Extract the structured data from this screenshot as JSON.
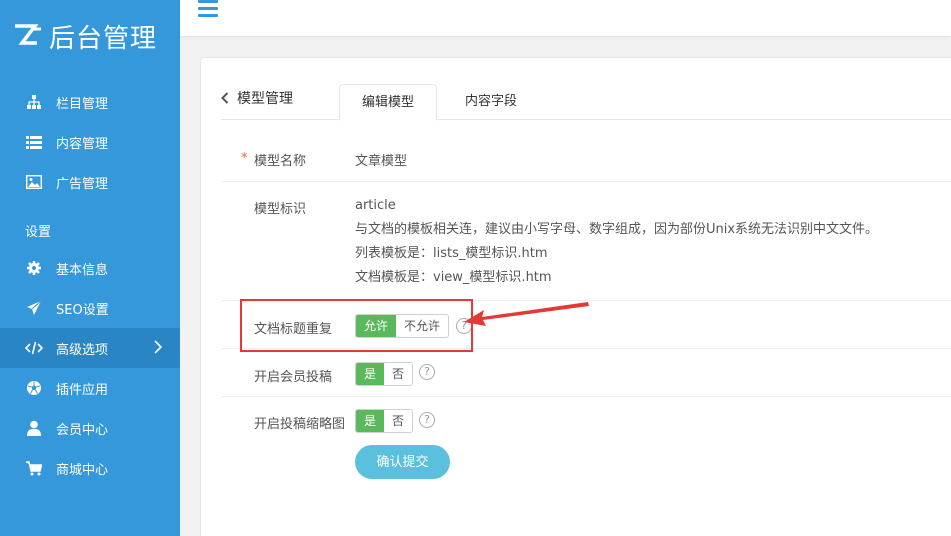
{
  "app": {
    "title": "后台管理",
    "brand_color": "#3498db"
  },
  "sidebar": {
    "items": [
      {
        "label": "栏目管理",
        "icon": "sitemap-icon"
      },
      {
        "label": "内容管理",
        "icon": "list-icon"
      },
      {
        "label": "广告管理",
        "icon": "image-icon"
      }
    ],
    "section_title": "设置",
    "settings": [
      {
        "label": "基本信息",
        "icon": "gear-icon"
      },
      {
        "label": "SEO设置",
        "icon": "send-icon"
      },
      {
        "label": "高级选项",
        "icon": "code-icon",
        "active": true
      },
      {
        "label": "插件应用",
        "icon": "soccer-icon"
      },
      {
        "label": "会员中心",
        "icon": "user-icon"
      },
      {
        "label": "商城中心",
        "icon": "cart-icon"
      }
    ]
  },
  "header": {
    "menu_icon": "hamburger-icon"
  },
  "tabs": {
    "back_label": "模型管理",
    "items": [
      {
        "label": "编辑模型",
        "active": true
      },
      {
        "label": "内容字段",
        "active": false
      }
    ]
  },
  "form": {
    "model_name": {
      "required_mark": "*",
      "label": "模型名称",
      "value": "文章模型"
    },
    "model_id": {
      "label": "模型标识",
      "value": "article",
      "desc_lines": [
        "与文档的模板相关连，建议由小写字母、数字组成，因为部份Unix系统无法识别中文文件。",
        "列表模板是：lists_模型标识.htm",
        "文档模板是：view_模型标识.htm"
      ]
    },
    "dup_title": {
      "label": "文档标题重复",
      "on": "允许",
      "off": "不允许",
      "selected": "允许",
      "help": "?"
    },
    "member_post": {
      "label": "开启会员投稿",
      "on": "是",
      "off": "否",
      "selected": "是",
      "help": "?"
    },
    "post_thumb": {
      "label": "开启投稿缩略图",
      "on": "是",
      "off": "否",
      "selected": "是",
      "help": "?"
    },
    "submit_label": "确认提交"
  },
  "colors": {
    "toggle_on": "#5cb85c",
    "submit": "#5bc0de",
    "annotation": "#e53935"
  }
}
